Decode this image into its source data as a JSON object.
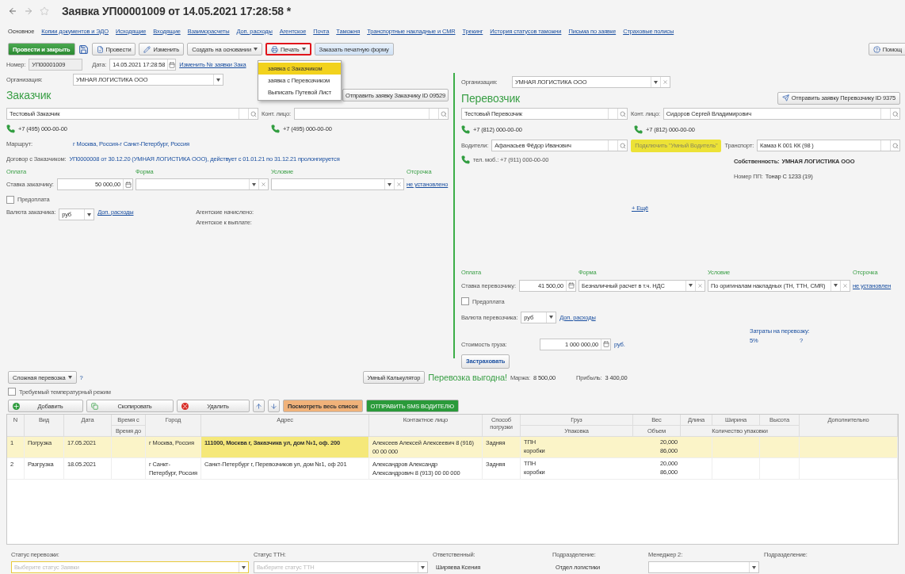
{
  "window": {
    "title": "Заявка УП00001009 от 14.05.2021 17:28:58 *"
  },
  "tabs": [
    {
      "label": "Основное",
      "selected": true
    },
    {
      "label": "Копии документов и ЭДО",
      "selected": false
    },
    {
      "label": "Исходящие",
      "selected": false
    },
    {
      "label": "Входящие",
      "selected": false
    },
    {
      "label": "Взаиморасчеты",
      "selected": false
    },
    {
      "label": "Доп. расходы",
      "selected": false
    },
    {
      "label": "Агентское",
      "selected": false
    },
    {
      "label": "Почта",
      "selected": false
    },
    {
      "label": "Таможня",
      "selected": false
    },
    {
      "label": "Транспортные накладные и CMR",
      "selected": false
    },
    {
      "label": "Трекинг",
      "selected": false
    },
    {
      "label": "История статусов таможни",
      "selected": false
    },
    {
      "label": "Письма по заявке",
      "selected": false
    },
    {
      "label": "Страховые полисы",
      "selected": false
    }
  ],
  "toolbar": {
    "post_close": "Провести и закрыть",
    "post": "Провести",
    "edit": "Изменить",
    "create_based": "Создать на основании",
    "print": "Печать",
    "print_highlighted": true,
    "order_form": "Заказать печатную форму",
    "help": "Помощ"
  },
  "print_menu": [
    {
      "label": "заявка с Заказчиком",
      "selected": true
    },
    {
      "label": "заявка с Перевозчиком",
      "selected": false
    },
    {
      "label": "Выписать Путевой Лист",
      "selected": false
    }
  ],
  "header": {
    "number_label": "Номер:",
    "number": "УП00001009",
    "date_label": "Дата:",
    "date": "14.05.2021 17:28:58",
    "change_link": "Изменить № заявки Зака"
  },
  "customer": {
    "org_label": "Организация:",
    "org": "УМНАЯ ЛОГИСТИКА ООО",
    "title": "Заказчик",
    "send_button": "Отправить заявку Заказчику ID 09529",
    "name": "Тестовый Заказчик",
    "contact_label": "Конт. лицо:",
    "phone": "+7 (495) 000-00-00",
    "contact_phone": "+7 (495) 000-00-00",
    "route_label": "Маршрут:",
    "route": "г Москва, Россия-г Санкт-Петербург, Россия",
    "contract_label": "Договор с Заказчиком:",
    "contract": "УП0000008 от 30.12.20 (УМНАЯ ЛОГИСТИКА ООО), действует с 01.01.21 по 31.12.21 пролонгируется",
    "pay_headers": [
      "Оплата",
      "Форма",
      "Условие",
      "Отсрочка"
    ],
    "rate_label": "Ставка заказчику:",
    "rate": "50 000,00",
    "delay": "не установлено",
    "prepay": {
      "label": "Предоплата",
      "checked": false
    },
    "currency_label": "Валюта заказчика:",
    "currency": "руб",
    "extra_link": "Доп. расходы",
    "agent_accrued": "Агентские начислено:",
    "agent_payable": "Агентское к выплате:"
  },
  "carrier": {
    "org_label": "Организация:",
    "org": "УМНАЯ ЛОГИСТИКА ООО",
    "title": "Перевозчик",
    "send_button": "Отправить заявку Перевозчику ID 9375",
    "name": "Тестовый Перевозчик",
    "contact_label": "Конт. лицо:",
    "contact": "Сидоров Сергей Владимирович",
    "phone": "+7 (812) 000-00-00",
    "contact_phone": "+7 (812) 000-00-00",
    "drivers_label": "Водители:",
    "driver": "Афанасьев Фёдор Иванович",
    "smart_driver_button": "Подключить \"Умный Водитель\"",
    "transport_label": "Транспорт:",
    "transport": "Камаз  К 001 КК (98 )",
    "driver_phone": "тел. моб.: +7 (911) 000-00-00",
    "ownership_label": "Собственность:",
    "ownership": "УМНАЯ ЛОГИСТИКА ООО",
    "trailer_label": "Номер ПП:",
    "trailer": "Тонар С 1233 (19)",
    "more_link": "+ Ещё",
    "pay_headers": [
      "Оплата",
      "Форма",
      "Условие",
      "Отсрочка"
    ],
    "rate_label": "Ставка перевозчику:",
    "rate": "41 500,00",
    "form": "Безналичный расчет в т.ч. НДС",
    "condition": "По оригиналам накладных (ТН, ТТН, CMR)",
    "delay": "не установлен",
    "prepay": {
      "label": "Предоплата",
      "checked": false
    },
    "currency_label": "Валюта перевозчика:",
    "currency": "руб",
    "extra_link": "Доп. расходы",
    "cargo_value_label": "Стоимость груза:",
    "cargo_value": "1 000 000,00",
    "cargo_currency": "руб.",
    "costs_label": "Затраты на перевозку:",
    "costs": "5%",
    "costs_help": "?",
    "insure_button": "Застраховать"
  },
  "summary": {
    "complex_button": "Сложная перевозка",
    "help": "?",
    "temperature": {
      "label": "Требуемый температурный режим",
      "checked": false
    },
    "calculator_button": "Умный Калькулятор",
    "verdict": "Перевозка выгодна!",
    "margin_label": "Маржа:",
    "margin": "8 500,00",
    "profit_label": "Прибыль:",
    "profit": "3 400,00"
  },
  "table_toolbar": {
    "add": "Добавить",
    "copy": "Скопировать",
    "delete": "Удалить",
    "show_all": "Посмотреть весь список",
    "send_sms": "ОТПРАВИТЬ SMS ВОДИТЕЛЮ"
  },
  "table": {
    "columns": [
      {
        "label": "N"
      },
      {
        "label": "Вид"
      },
      {
        "label": "Дата"
      },
      {
        "label": "Время с",
        "sub": "Время до"
      },
      {
        "label": "Город"
      },
      {
        "label": "Адрес"
      },
      {
        "label": "Контактное лицо"
      },
      {
        "label": "Способ погрузки"
      },
      {
        "label": "Груз",
        "sub": "Упаковка"
      },
      {
        "label": "Вес",
        "sub": "Объем"
      },
      {
        "label": "Длина"
      },
      {
        "label": "Ширина"
      },
      {
        "label": "Высота"
      },
      {
        "label": "Дополнительно"
      }
    ],
    "group_label": "Количество упаковки",
    "rows": [
      {
        "n": "1",
        "type": "Погрузка",
        "date": "17.05.2021",
        "city": "г Москва, Россия",
        "address": "111000, Москва г, Заказчика ул, дом №1, оф. 200",
        "contact": "Алексеев Алексей Алексеевич 8 (916) 00 00 000",
        "method": "Задняя",
        "cargo": "ТПН",
        "packaging": "коробки",
        "weight": "20,000",
        "volume": "86,000",
        "selected": true
      },
      {
        "n": "2",
        "type": "Разгрузка",
        "date": "18.05.2021",
        "city": "г Санкт-Петербург, Россия",
        "address": "Санкт-Петербург г, Перевозчиков ул, дом №1, оф 201",
        "contact": "Александров Александр Александрович 8 (913) 00 00 000",
        "method": "Задняя",
        "cargo": "ТПН",
        "packaging": "коробки",
        "weight": "20,000",
        "volume": "86,000",
        "selected": false
      }
    ]
  },
  "footer": {
    "transport_status_label": "Статус перевозки:",
    "transport_status_placeholder": "Выберите статус Заявки",
    "ttn_status_label": "Статус ТТН:",
    "ttn_status_placeholder": "Выберите статус ТТН",
    "responsible_label": "Ответственный:",
    "responsible": "Ширяева Ксения",
    "department_label": "Подразделение:",
    "department": "Отдел логистики",
    "manager2_label": "Менеджер 2:",
    "department2_label": "Подразделение:"
  }
}
